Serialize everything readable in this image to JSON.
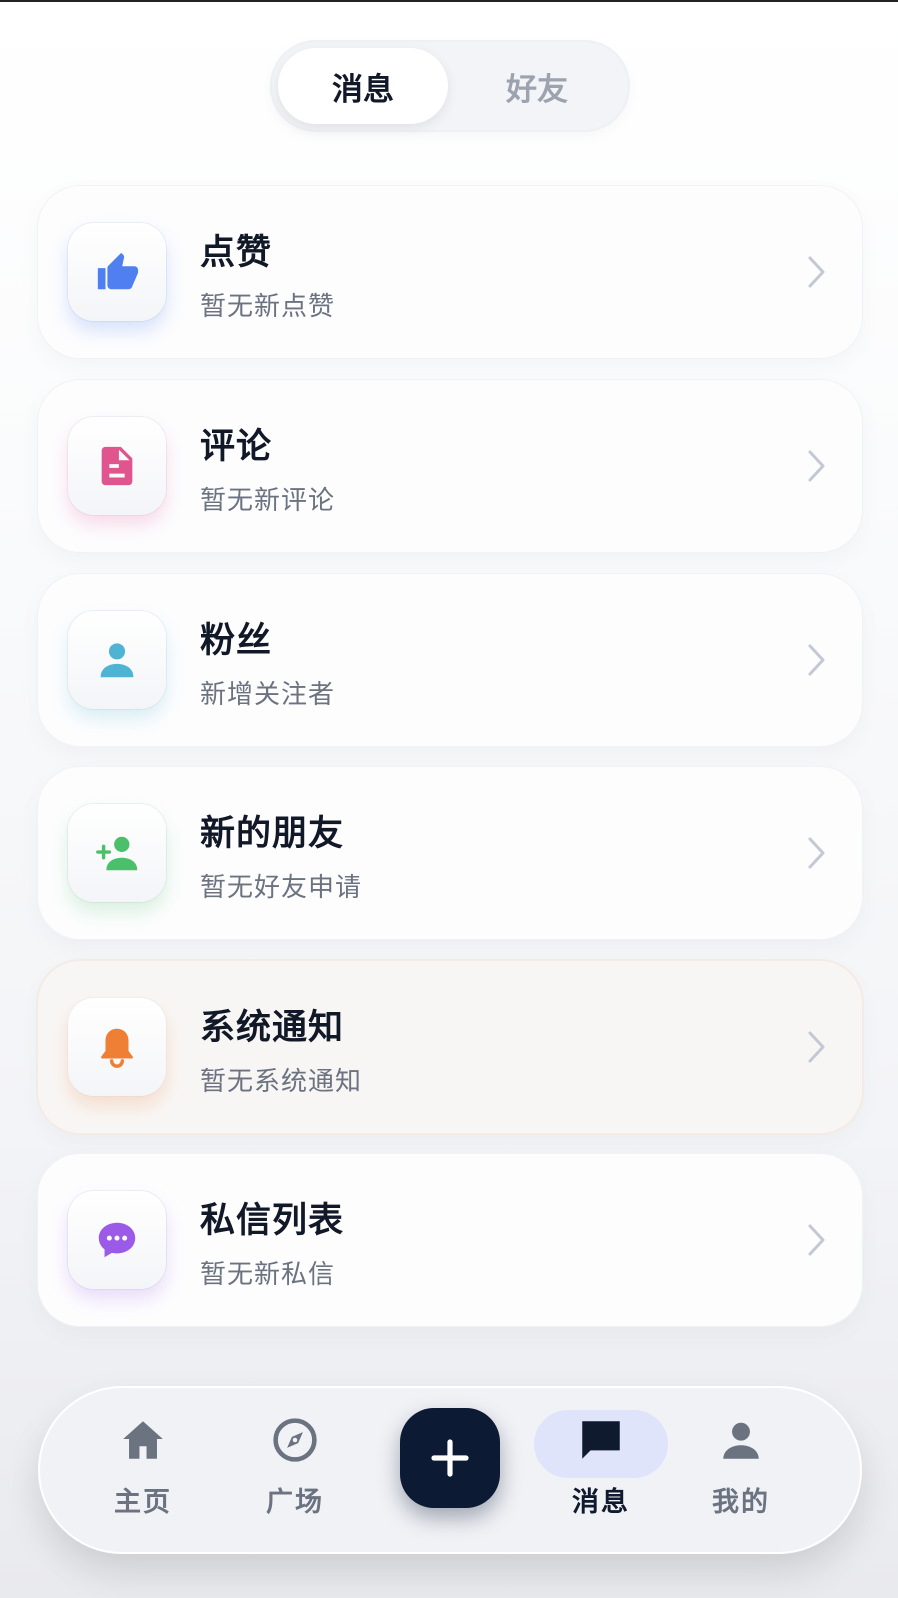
{
  "tabs": {
    "messages": "消息",
    "friends": "好友"
  },
  "items": [
    {
      "title": "点赞",
      "subtitle": "暂无新点赞",
      "icon": "thumbs-up-icon",
      "color": "#4f7ff0"
    },
    {
      "title": "评论",
      "subtitle": "暂无新评论",
      "icon": "document-icon",
      "color": "#e0558e"
    },
    {
      "title": "粉丝",
      "subtitle": "新增关注者",
      "icon": "person-icon",
      "color": "#4fb3d4"
    },
    {
      "title": "新的朋友",
      "subtitle": "暂无好友申请",
      "icon": "add-person-icon",
      "color": "#4cbf6a"
    },
    {
      "title": "系统通知",
      "subtitle": "暂无系统通知",
      "icon": "bell-icon",
      "color": "#ef7f35"
    },
    {
      "title": "私信列表",
      "subtitle": "暂无新私信",
      "icon": "chat-bubble-icon",
      "color": "#9b5ae8"
    }
  ],
  "nav": {
    "home": "主页",
    "square": "广场",
    "messages": "消息",
    "me": "我的",
    "active": "messages"
  }
}
